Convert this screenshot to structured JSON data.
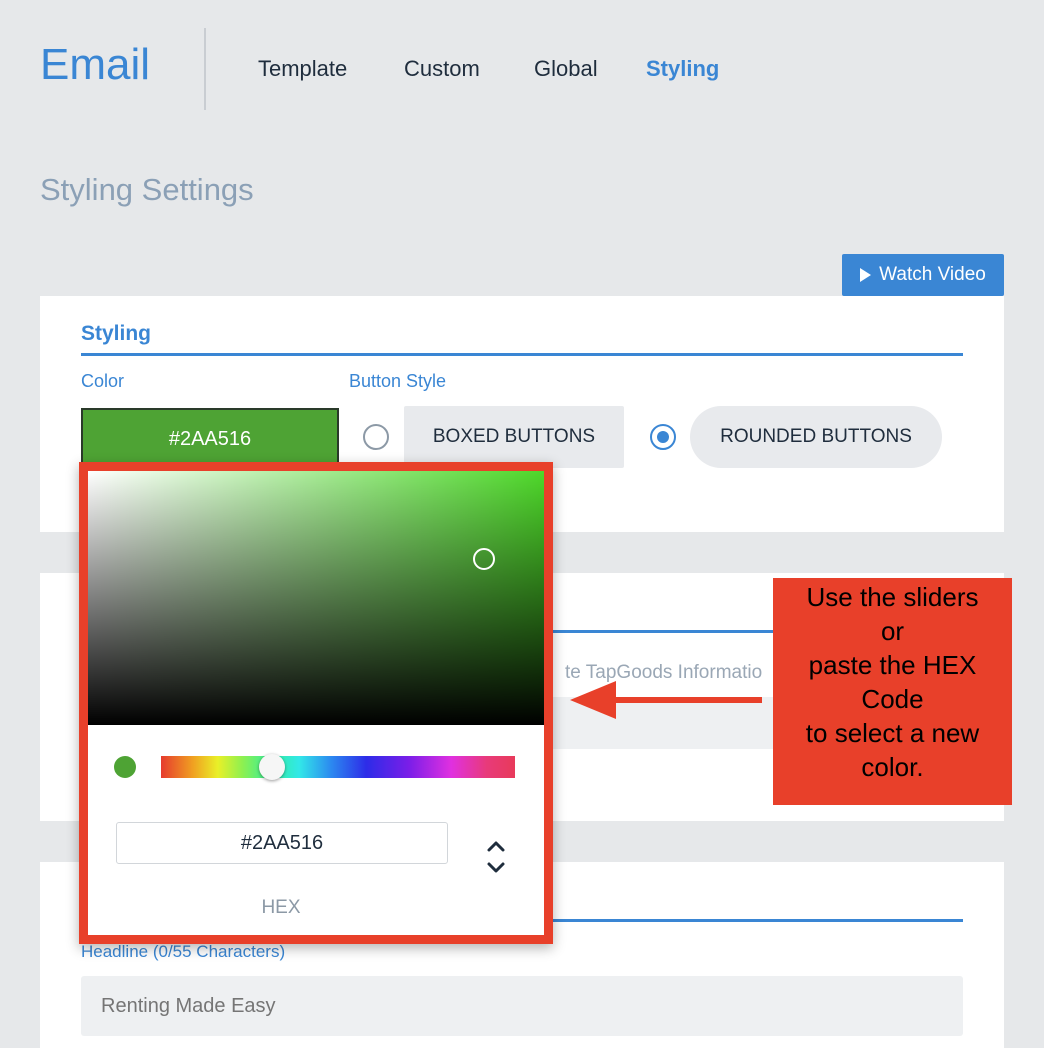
{
  "header": {
    "app_title": "Email",
    "tabs": [
      {
        "label": "Template",
        "active": false
      },
      {
        "label": "Custom",
        "active": false
      },
      {
        "label": "Global",
        "active": false
      },
      {
        "label": "Styling",
        "active": true
      }
    ]
  },
  "page": {
    "section_heading": "Styling Settings",
    "watch_video_label": "Watch Video"
  },
  "styling_card": {
    "title": "Styling",
    "color_label": "Color",
    "color_value": "#2AA516",
    "button_style_label": "Button Style",
    "options": [
      {
        "label": "BOXED BUTTONS",
        "selected": false
      },
      {
        "label": "ROUNDED BUTTONS",
        "selected": true
      }
    ]
  },
  "second_card": {
    "partial_text": "te TapGoods Informatio"
  },
  "headline_card": {
    "headline_label": "Headline (0/55 Characters)",
    "headline_placeholder": "Renting Made Easy"
  },
  "color_picker": {
    "hex_value": "#2AA516",
    "mode_label": "HEX"
  },
  "annotation": {
    "lines": [
      "Use the sliders",
      "or",
      "paste the HEX",
      "Code",
      "to select a new",
      "color."
    ]
  },
  "colors": {
    "accent": "#3A86D4",
    "annotation_red": "#E8402A",
    "swatch_green": "#4EA334"
  },
  "icons": {
    "play": "play-icon",
    "toggle": "chevron-up-down-icon",
    "arrow": "arrow-left-icon"
  }
}
